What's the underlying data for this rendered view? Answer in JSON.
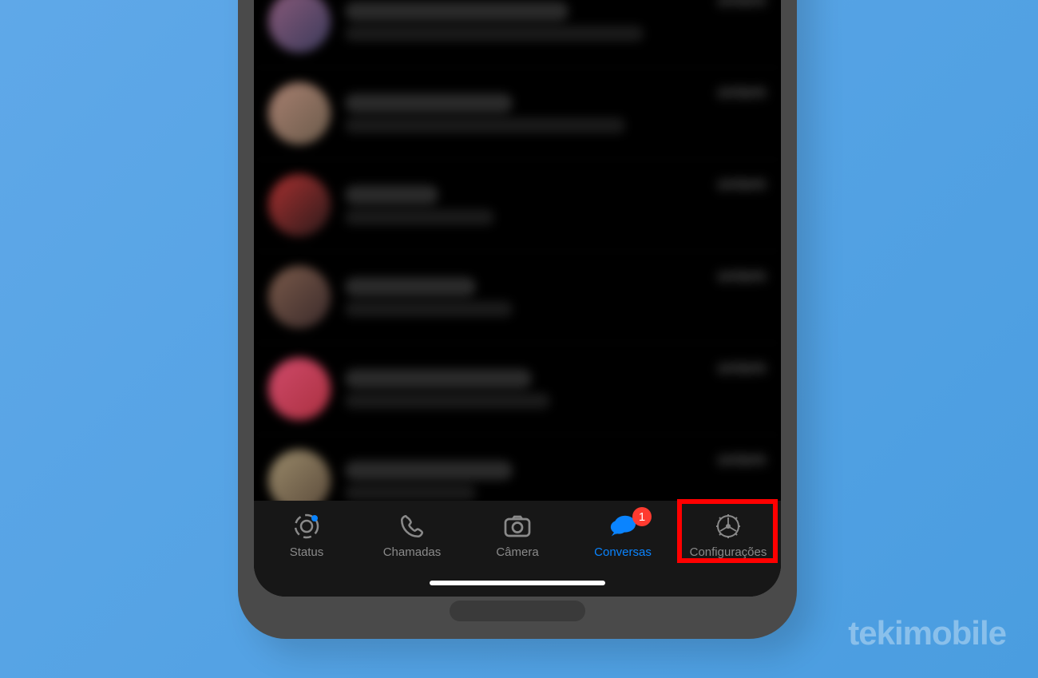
{
  "watermark": "tekimobile",
  "chats": [
    {
      "avatar_bg": "linear-gradient(135deg,#8a5a7a,#3a3a5a)",
      "name_w": "60%",
      "preview_w": "80%",
      "time": "ontem"
    },
    {
      "avatar_bg": "linear-gradient(135deg,#a88070,#6a5a4a)",
      "name_w": "45%",
      "preview_w": "75%",
      "time": "ontem"
    },
    {
      "avatar_bg": "linear-gradient(135deg,#aa3030,#2a1a1a)",
      "name_w": "25%",
      "preview_w": "40%",
      "time": "ontem"
    },
    {
      "avatar_bg": "linear-gradient(135deg,#7a5a4a,#3a2a2a)",
      "name_w": "35%",
      "preview_w": "45%",
      "time": "ontem"
    },
    {
      "avatar_bg": "linear-gradient(135deg,#d04a6a,#aa3040)",
      "name_w": "50%",
      "preview_w": "55%",
      "time": "ontem"
    },
    {
      "avatar_bg": "linear-gradient(135deg,#9a8a6a,#5a4a3a)",
      "name_w": "45%",
      "preview_w": "35%",
      "time": "ontem"
    }
  ],
  "tabs": {
    "status": "Status",
    "calls": "Chamadas",
    "camera": "Câmera",
    "chats": "Conversas",
    "settings": "Configurações",
    "badge": "1"
  },
  "active_tab": "chats",
  "highlighted_tab": "settings"
}
